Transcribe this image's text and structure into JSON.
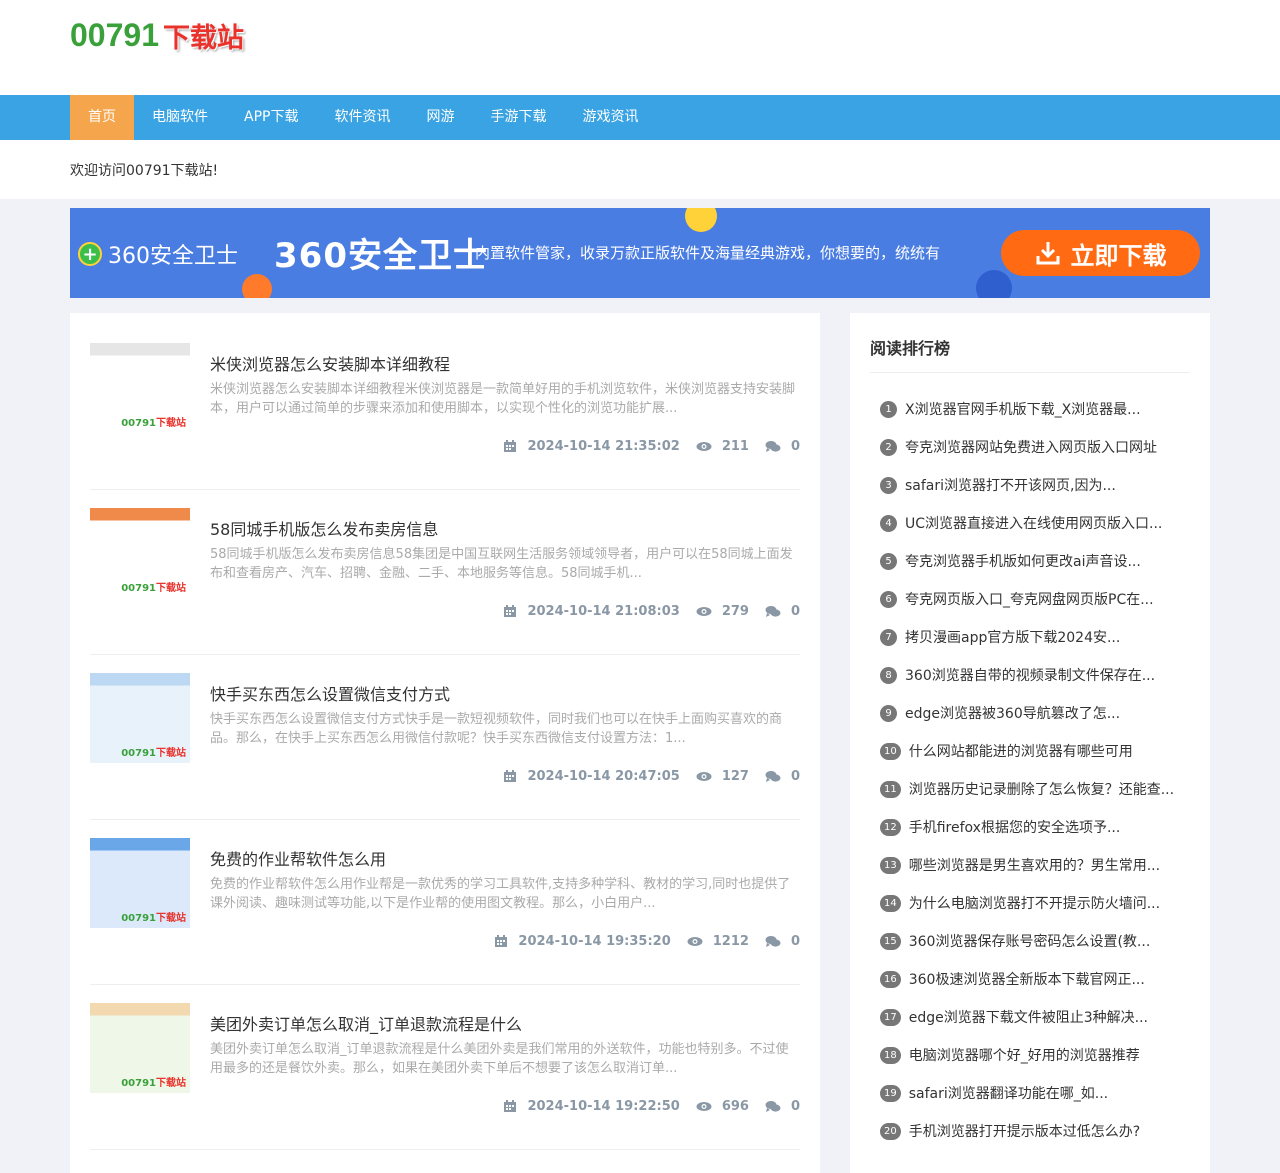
{
  "site": {
    "logo_num": "00791",
    "logo_cn": "下载站"
  },
  "nav": {
    "items": [
      "首页",
      "电脑软件",
      "APP下载",
      "软件资讯",
      "网游",
      "手游下载",
      "游戏资讯"
    ],
    "active_index": 0
  },
  "welcome": "欢迎访问00791下载站!",
  "banner": {
    "brand": "360安全卫士",
    "title": "360安全卫士",
    "desc": "内置软件管家，收录万款正版软件及海量经典游戏，你想要的，统统有",
    "button": "立即下载"
  },
  "articles": [
    {
      "title": "米侠浏览器怎么安装脚本详细教程",
      "desc": "米侠浏览器怎么安装脚本详细教程米侠浏览器是一款简单好用的手机浏览软件，米侠浏览器支持安装脚本，用户可以通过简单的步骤来添加和使用脚本，以实现个性化的浏览功能扩展...",
      "date": "2024-10-14 21:35:02",
      "views": "211",
      "comments": "0"
    },
    {
      "title": "58同城手机版怎么发布卖房信息",
      "desc": "58同城手机版怎么发布卖房信息58集团是中国互联网生活服务领域领导者，用户可以在58同城上面发布和查看房产、汽车、招聘、金融、二手、本地服务等信息。58同城手机...",
      "date": "2024-10-14 21:08:03",
      "views": "279",
      "comments": "0"
    },
    {
      "title": "快手买东西怎么设置微信支付方式",
      "desc": "快手买东西怎么设置微信支付方式快手是一款短视频软件，同时我们也可以在快手上面购买喜欢的商品。那么，在快手上买东西怎么用微信付款呢？快手买东西微信支付设置方法：1...",
      "date": "2024-10-14 20:47:05",
      "views": "127",
      "comments": "0"
    },
    {
      "title": "免费的作业帮软件怎么用",
      "desc": "免费的作业帮软件怎么用作业帮是一款优秀的学习工具软件,支持多种学科、教材的学习,同时也提供了课外阅读、趣味测试等功能,以下是作业帮的使用图文教程。那么，小白用户...",
      "date": "2024-10-14 19:35:20",
      "views": "1212",
      "comments": "0"
    },
    {
      "title": "美团外卖订单怎么取消_订单退款流程是什么",
      "desc": "美团外卖订单怎么取消_订单退款流程是什么美团外卖是我们常用的外送软件，功能也特别多。不过使用最多的还是餐饮外卖。那么，如果在美团外卖下单后不想要了该怎么取消订单...",
      "date": "2024-10-14 19:22:50",
      "views": "696",
      "comments": "0"
    }
  ],
  "sidebar": {
    "title": "阅读排行榜",
    "items": [
      {
        "n": "1",
        "t": "X浏览器官网手机版下载_X浏览器最..."
      },
      {
        "n": "2",
        "t": "夸克浏览器网站免费进入网页版入口网址"
      },
      {
        "n": "3",
        "t": "safari浏览器打不开该网页,因为..."
      },
      {
        "n": "4",
        "t": "UC浏览器直接进入在线使用网页版入口..."
      },
      {
        "n": "5",
        "t": "夸克浏览器手机版如何更改ai声音设..."
      },
      {
        "n": "6",
        "t": "夸克网页版入口_夸克网盘网页版PC在..."
      },
      {
        "n": "7",
        "t": "拷贝漫画app官方版下载2024安..."
      },
      {
        "n": "8",
        "t": "360浏览器自带的视频录制文件保存在..."
      },
      {
        "n": "9",
        "t": "edge浏览器被360导航篡改了怎..."
      },
      {
        "n": "10",
        "t": "什么网站都能进的浏览器有哪些可用"
      },
      {
        "n": "11",
        "t": "浏览器历史记录删除了怎么恢复？还能查..."
      },
      {
        "n": "12",
        "t": "手机firefox根据您的安全选项予..."
      },
      {
        "n": "13",
        "t": "哪些浏览器是男生喜欢用的？男生常用..."
      },
      {
        "n": "14",
        "t": "为什么电脑浏览器打不开提示防火墙问..."
      },
      {
        "n": "15",
        "t": "360浏览器保存账号密码怎么设置(教..."
      },
      {
        "n": "16",
        "t": "360极速浏览器全新版本下载官网正..."
      },
      {
        "n": "17",
        "t": "edge浏览器下载文件被阻止3种解决..."
      },
      {
        "n": "18",
        "t": "电脑浏览器哪个好_好用的浏览器推荐"
      },
      {
        "n": "19",
        "t": "safari浏览器翻译功能在哪_如..."
      },
      {
        "n": "20",
        "t": "手机浏览器打开提示版本过低怎么办?"
      }
    ]
  },
  "colors": {
    "nav_bg": "#3aa3e3",
    "nav_active": "#f5a54b",
    "banner_bg": "#4a7de2",
    "banner_btn": "#ff6a13"
  }
}
